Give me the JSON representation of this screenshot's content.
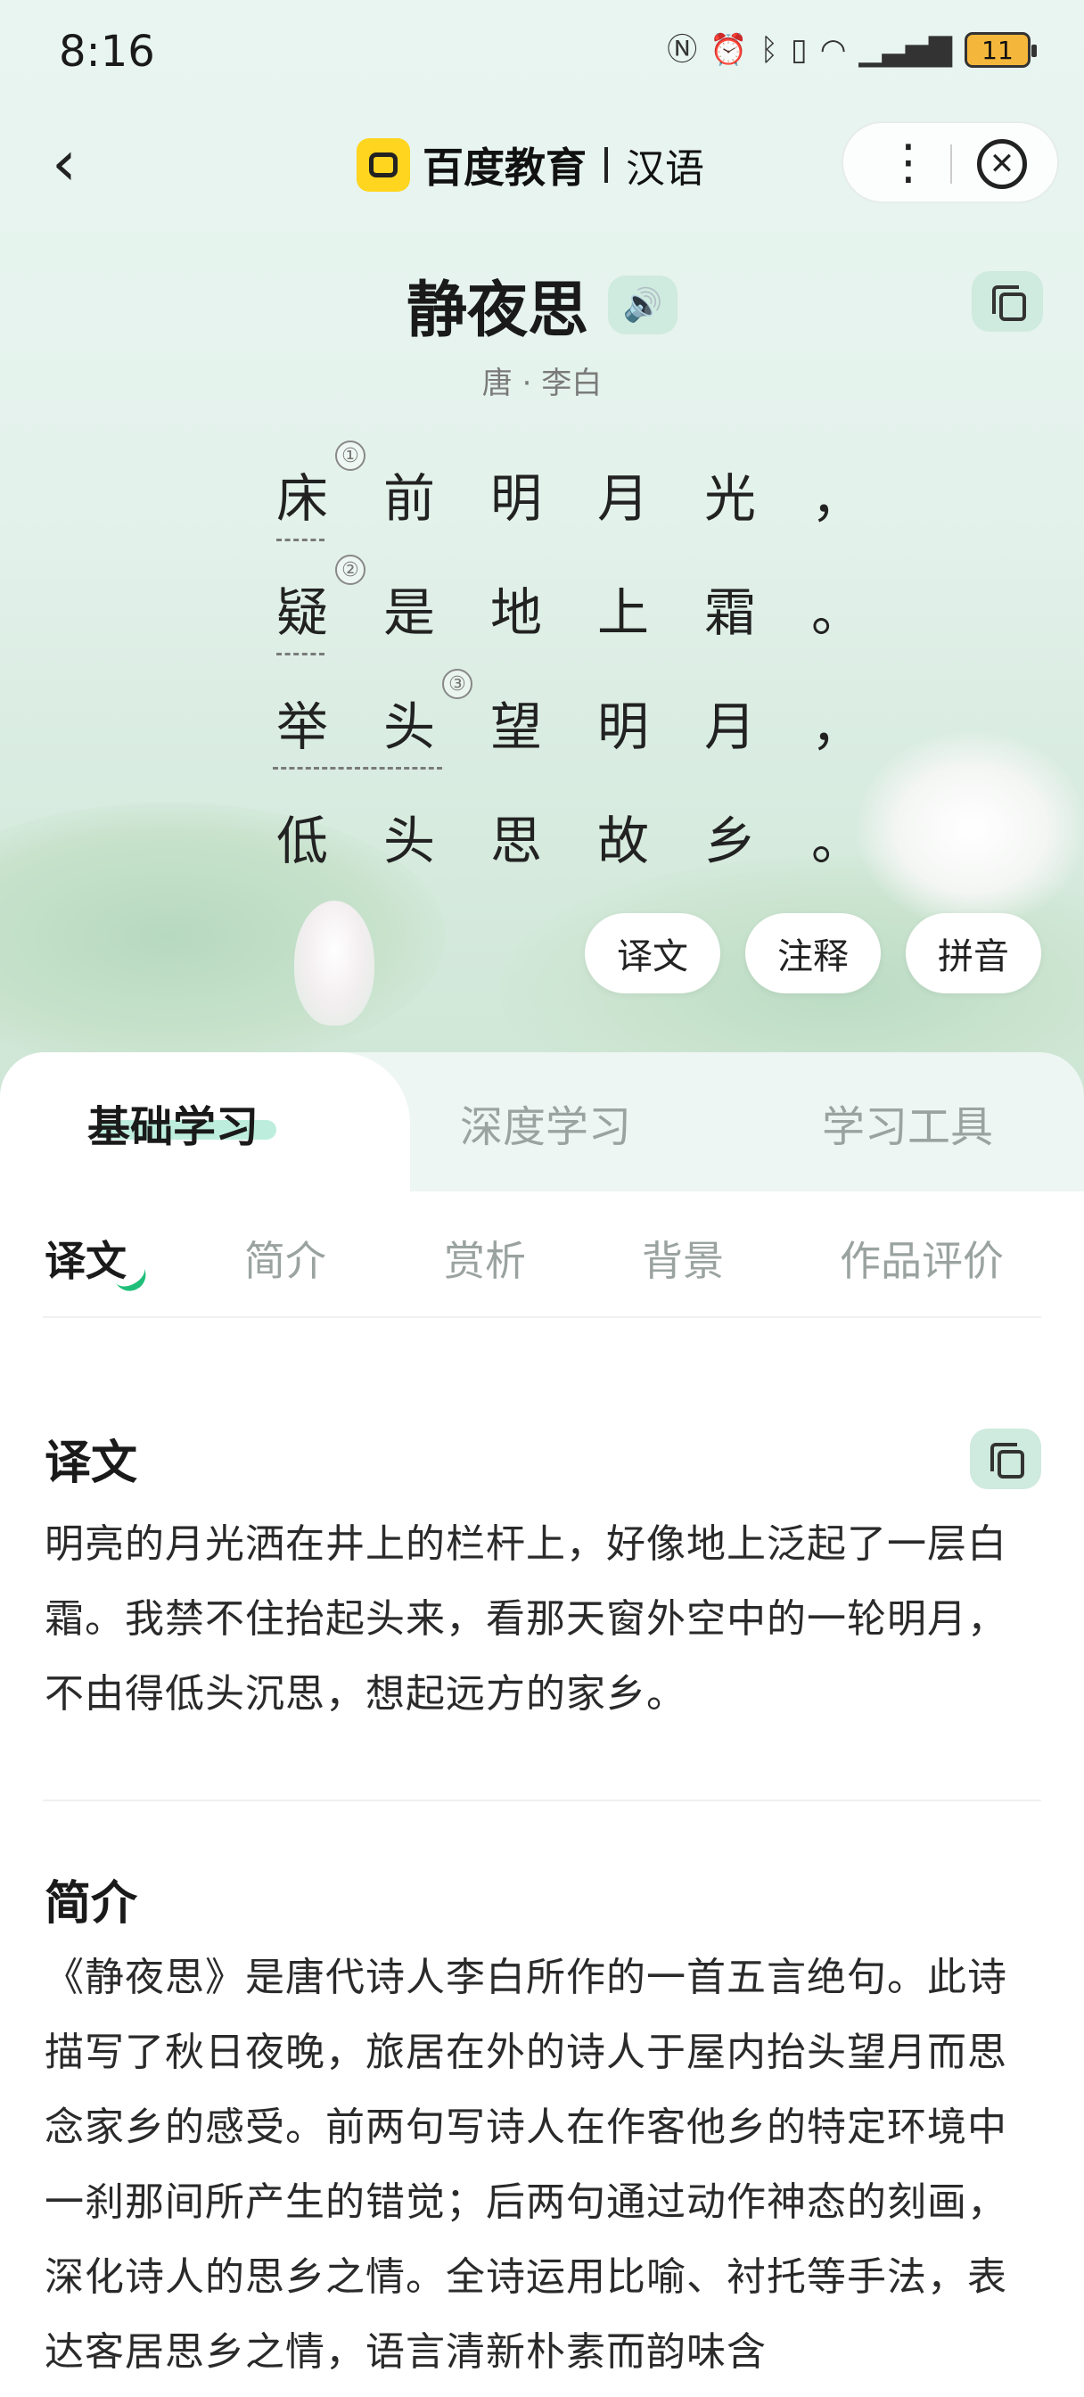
{
  "status_bar": {
    "time": "8:16",
    "battery": "11",
    "icons": [
      "nfc-icon",
      "alarm-icon",
      "bluetooth-icon",
      "vibrate-icon",
      "wifi-icon",
      "signal-icon",
      "battery-icon"
    ]
  },
  "nav": {
    "brand": "百度教育",
    "sub": "汉语"
  },
  "poem": {
    "title": "静夜思",
    "author": "唐 · 李白",
    "lines": [
      [
        "床",
        "前",
        "明",
        "月",
        "光",
        "，"
      ],
      [
        "疑",
        "是",
        "地",
        "上",
        "霜",
        "。"
      ],
      [
        "举",
        "头",
        "望",
        "明",
        "月",
        "，"
      ],
      [
        "低",
        "头",
        "思",
        "故",
        "乡",
        "。"
      ]
    ],
    "note_marks": [
      "①",
      "②",
      "③"
    ],
    "pills": [
      "译文",
      "注释",
      "拼音"
    ]
  },
  "main_tabs": [
    "基础学习",
    "深度学习",
    "学习工具"
  ],
  "sub_tabs": [
    "译文",
    "简介",
    "赏析",
    "背景",
    "作品评价"
  ],
  "sections": {
    "translation": {
      "title": "译文",
      "text": "明亮的月光洒在井上的栏杆上，好像地上泛起了一层白霜。我禁不住抬起头来，看那天窗外空中的一轮明月，不由得低头沉思，想起远方的家乡。"
    },
    "intro": {
      "title": "简介",
      "text": "《静夜思》是唐代诗人李白所作的一首五言绝句。此诗描写了秋日夜晚，旅居在外的诗人于屋内抬头望月而思念家乡的感受。前两句写诗人在作客他乡的特定环境中一刹那间所产生的错觉；后两句通过动作神态的刻画，深化诗人的思乡之情。全诗运用比喻、衬托等手法，表达客居思乡之情，语言清新朴素而韵味含"
    }
  },
  "colors": {
    "accent": "#1fbf7a",
    "mint": "#cfeadf",
    "brand_yellow": "#ffd51f"
  }
}
